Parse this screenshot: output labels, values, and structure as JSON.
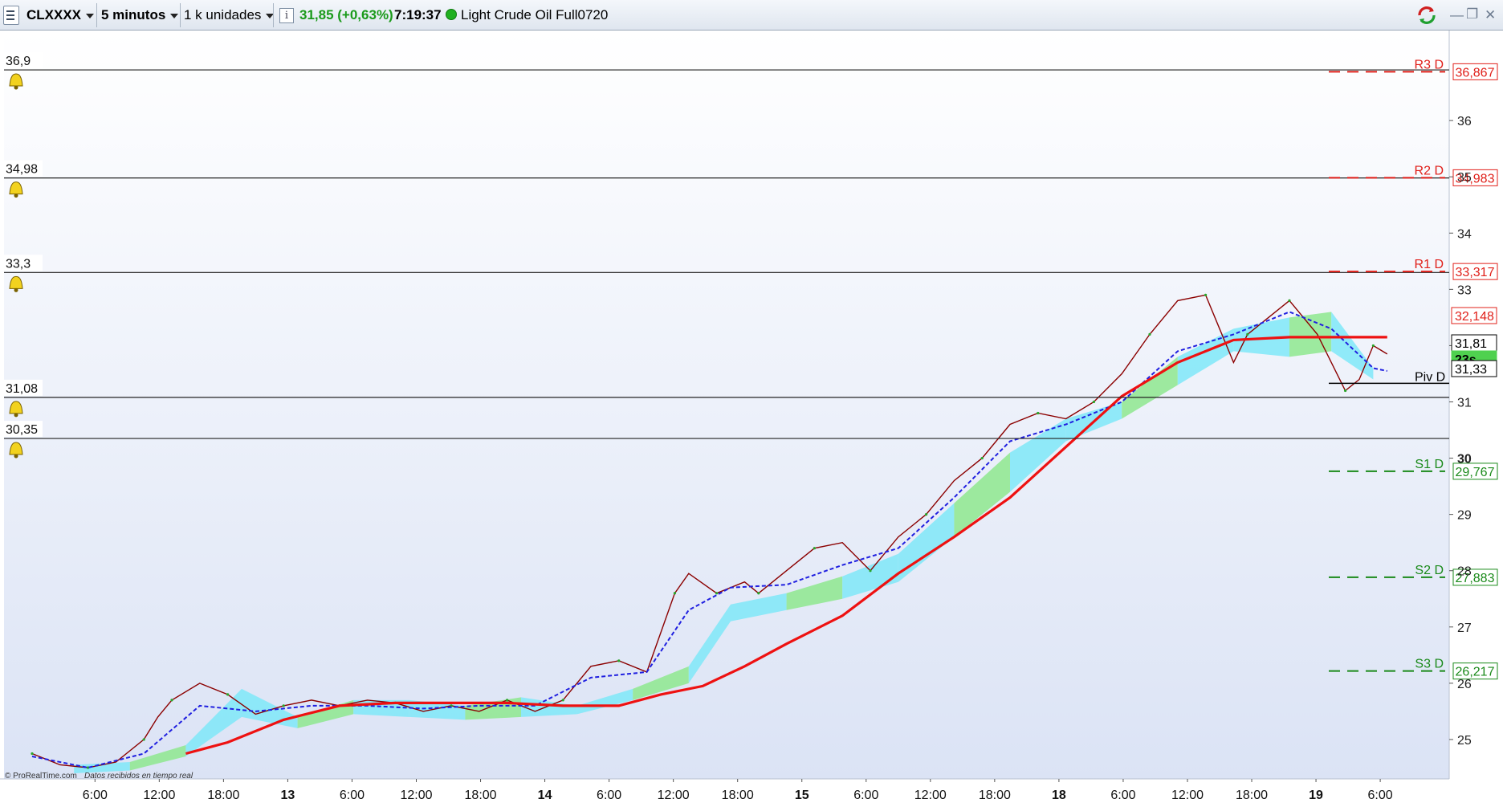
{
  "toolbar": {
    "symbol": "CLXXXX",
    "timeframe": "5 minutos",
    "units": "1 k unidades",
    "info_icon": "info-icon",
    "price_change": "31,85 (+0,63%)",
    "time": "7:19:37",
    "status_icon": "green-dot-icon",
    "instrument": "Light Crude Oil Full0720",
    "window_controls": [
      "minimize-icon",
      "restore-icon",
      "close-icon"
    ]
  },
  "alert_lines": [
    {
      "label": "36,9",
      "value": 36.9
    },
    {
      "label": "34,98",
      "value": 34.98
    },
    {
      "label": "33,3",
      "value": 33.3
    },
    {
      "label": "31,08",
      "value": 31.08
    },
    {
      "label": "30,35",
      "value": 30.35
    }
  ],
  "pivot_levels": [
    {
      "name": "R3 D",
      "label": "36,867",
      "value": 36.867,
      "color": "#e0201a"
    },
    {
      "name": "R2 D",
      "label": "34,983",
      "value": 34.983,
      "color": "#e0201a"
    },
    {
      "name": "R1 D",
      "label": "33,317",
      "value": 33.317,
      "color": "#e0201a"
    },
    {
      "name": "Piv D",
      "label": "",
      "value": 31.33,
      "color": "#000000"
    },
    {
      "name": "S1 D",
      "label": "29,767",
      "value": 29.767,
      "color": "#1a8a1a"
    },
    {
      "name": "S2 D",
      "label": "27,883",
      "value": 27.883,
      "color": "#1a8a1a"
    },
    {
      "name": "S3 D",
      "label": "26,217",
      "value": 26.217,
      "color": "#1a8a1a"
    }
  ],
  "price_tags": [
    {
      "label": "32,148",
      "value": 32.148,
      "color": "#e0201a"
    },
    {
      "label": "31,81",
      "value": 31.81,
      "color": "#000000"
    },
    {
      "label": "23s",
      "value": 31.4,
      "color": "#000000"
    },
    {
      "label": "31,33",
      "value": 31.33,
      "color": "#000000"
    }
  ],
  "footer": {
    "brand": "© ProRealTime.com",
    "feed": "Datos recibidos en tiempo real"
  },
  "chart_data": {
    "type": "line",
    "title": "",
    "ylim": [
      24.3,
      37.6
    ],
    "y_ticks": [
      {
        "label": "36",
        "value": 36
      },
      {
        "label": "35",
        "value": 35
      },
      {
        "label": "34",
        "value": 34
      },
      {
        "label": "33",
        "value": 33
      },
      {
        "label": "32",
        "value": 32
      },
      {
        "label": "31",
        "value": 31
      },
      {
        "label": "30",
        "value": 30
      },
      {
        "label": "29",
        "value": 29
      },
      {
        "label": "28",
        "value": 28
      },
      {
        "label": "27",
        "value": 27
      },
      {
        "label": "26",
        "value": 26
      },
      {
        "label": "25",
        "value": 25
      }
    ],
    "x_ticks": [
      {
        "label": "6:00",
        "t": 0.045,
        "bold": false
      },
      {
        "label": "12:00",
        "t": 0.091,
        "bold": false
      },
      {
        "label": "18:00",
        "t": 0.137,
        "bold": false
      },
      {
        "label": "13",
        "t": 0.183,
        "bold": true
      },
      {
        "label": "6:00",
        "t": 0.229,
        "bold": false
      },
      {
        "label": "12:00",
        "t": 0.275,
        "bold": false
      },
      {
        "label": "18:00",
        "t": 0.321,
        "bold": false
      },
      {
        "label": "14",
        "t": 0.367,
        "bold": true
      },
      {
        "label": "6:00",
        "t": 0.413,
        "bold": false
      },
      {
        "label": "12:00",
        "t": 0.459,
        "bold": false
      },
      {
        "label": "18:00",
        "t": 0.505,
        "bold": false
      },
      {
        "label": "15",
        "t": 0.551,
        "bold": true
      },
      {
        "label": "6:00",
        "t": 0.597,
        "bold": false
      },
      {
        "label": "12:00",
        "t": 0.643,
        "bold": false
      },
      {
        "label": "18:00",
        "t": 0.689,
        "bold": false
      },
      {
        "label": "18",
        "t": 0.735,
        "bold": true
      },
      {
        "label": "6:00",
        "t": 0.781,
        "bold": false
      },
      {
        "label": "12:00",
        "t": 0.827,
        "bold": false
      },
      {
        "label": "18:00",
        "t": 0.873,
        "bold": false
      },
      {
        "label": "19",
        "t": 0.919,
        "bold": true
      },
      {
        "label": "6:00",
        "t": 0.965,
        "bold": false
      }
    ],
    "series": [
      {
        "name": "",
        "style": "price",
        "color": "#8b0000",
        "x": [
          0.0,
          0.02,
          0.04,
          0.06,
          0.08,
          0.09,
          0.1,
          0.12,
          0.14,
          0.16,
          0.18,
          0.2,
          0.22,
          0.24,
          0.26,
          0.28,
          0.3,
          0.32,
          0.34,
          0.36,
          0.38,
          0.4,
          0.42,
          0.44,
          0.46,
          0.47,
          0.49,
          0.51,
          0.52,
          0.54,
          0.56,
          0.58,
          0.6,
          0.62,
          0.64,
          0.66,
          0.68,
          0.7,
          0.72,
          0.74,
          0.76,
          0.78,
          0.8,
          0.82,
          0.84,
          0.86,
          0.87,
          0.88,
          0.9,
          0.92,
          0.94,
          0.95,
          0.96,
          0.97
        ],
        "y": [
          24.75,
          24.55,
          24.5,
          24.6,
          25.0,
          25.4,
          25.7,
          26.0,
          25.8,
          25.45,
          25.6,
          25.7,
          25.6,
          25.7,
          25.65,
          25.5,
          25.6,
          25.5,
          25.7,
          25.5,
          25.7,
          26.3,
          26.4,
          26.2,
          27.6,
          27.95,
          27.6,
          27.8,
          27.6,
          28.0,
          28.4,
          28.5,
          28.0,
          28.6,
          29.0,
          29.6,
          30.0,
          30.6,
          30.8,
          30.7,
          31.0,
          31.5,
          32.2,
          32.8,
          32.9,
          31.7,
          32.2,
          32.4,
          32.8,
          32.2,
          31.2,
          31.4,
          32.0,
          31.85
        ]
      },
      {
        "name": "",
        "style": "dashed",
        "color": "#2020e0",
        "x": [
          0.0,
          0.04,
          0.08,
          0.12,
          0.16,
          0.2,
          0.24,
          0.28,
          0.32,
          0.36,
          0.4,
          0.44,
          0.47,
          0.5,
          0.54,
          0.58,
          0.62,
          0.66,
          0.7,
          0.74,
          0.78,
          0.82,
          0.86,
          0.9,
          0.93,
          0.96,
          0.97
        ],
        "y": [
          24.7,
          24.5,
          24.75,
          25.6,
          25.5,
          25.6,
          25.6,
          25.55,
          25.6,
          25.6,
          26.1,
          26.2,
          27.3,
          27.7,
          27.75,
          28.1,
          28.4,
          29.3,
          30.3,
          30.6,
          31.0,
          31.9,
          32.2,
          32.6,
          32.3,
          31.6,
          31.55
        ]
      },
      {
        "name": "",
        "style": "ma",
        "color": "#ee1111",
        "x": [
          0.11,
          0.14,
          0.18,
          0.22,
          0.26,
          0.3,
          0.34,
          0.38,
          0.42,
          0.45,
          0.48,
          0.51,
          0.54,
          0.58,
          0.62,
          0.66,
          0.7,
          0.74,
          0.78,
          0.82,
          0.86,
          0.9,
          0.93,
          0.95,
          0.97
        ],
        "y": [
          24.75,
          24.95,
          25.35,
          25.6,
          25.65,
          25.65,
          25.65,
          25.6,
          25.6,
          25.8,
          25.95,
          26.3,
          26.7,
          27.2,
          27.95,
          28.6,
          29.3,
          30.2,
          31.1,
          31.7,
          32.1,
          32.15,
          32.15,
          32.15,
          32.15
        ]
      }
    ],
    "cloud": {
      "x": [
        0.03,
        0.07,
        0.11,
        0.15,
        0.19,
        0.23,
        0.27,
        0.31,
        0.35,
        0.39,
        0.43,
        0.47,
        0.5,
        0.54,
        0.58,
        0.62,
        0.66,
        0.7,
        0.74,
        0.78,
        0.82,
        0.86,
        0.9,
        0.93,
        0.96
      ],
      "upper": [
        24.55,
        24.6,
        24.9,
        25.9,
        25.4,
        25.7,
        25.7,
        25.6,
        25.75,
        25.6,
        25.9,
        26.3,
        27.4,
        27.6,
        27.9,
        28.3,
        29.2,
        30.1,
        30.7,
        31.0,
        31.8,
        32.3,
        32.5,
        32.6,
        31.6
      ],
      "lower": [
        24.4,
        24.45,
        24.7,
        25.4,
        25.2,
        25.45,
        25.4,
        25.35,
        25.4,
        25.45,
        25.7,
        26.0,
        27.1,
        27.3,
        27.5,
        27.8,
        28.6,
        29.4,
        30.3,
        30.7,
        31.3,
        31.9,
        31.8,
        31.9,
        31.4
      ]
    }
  }
}
